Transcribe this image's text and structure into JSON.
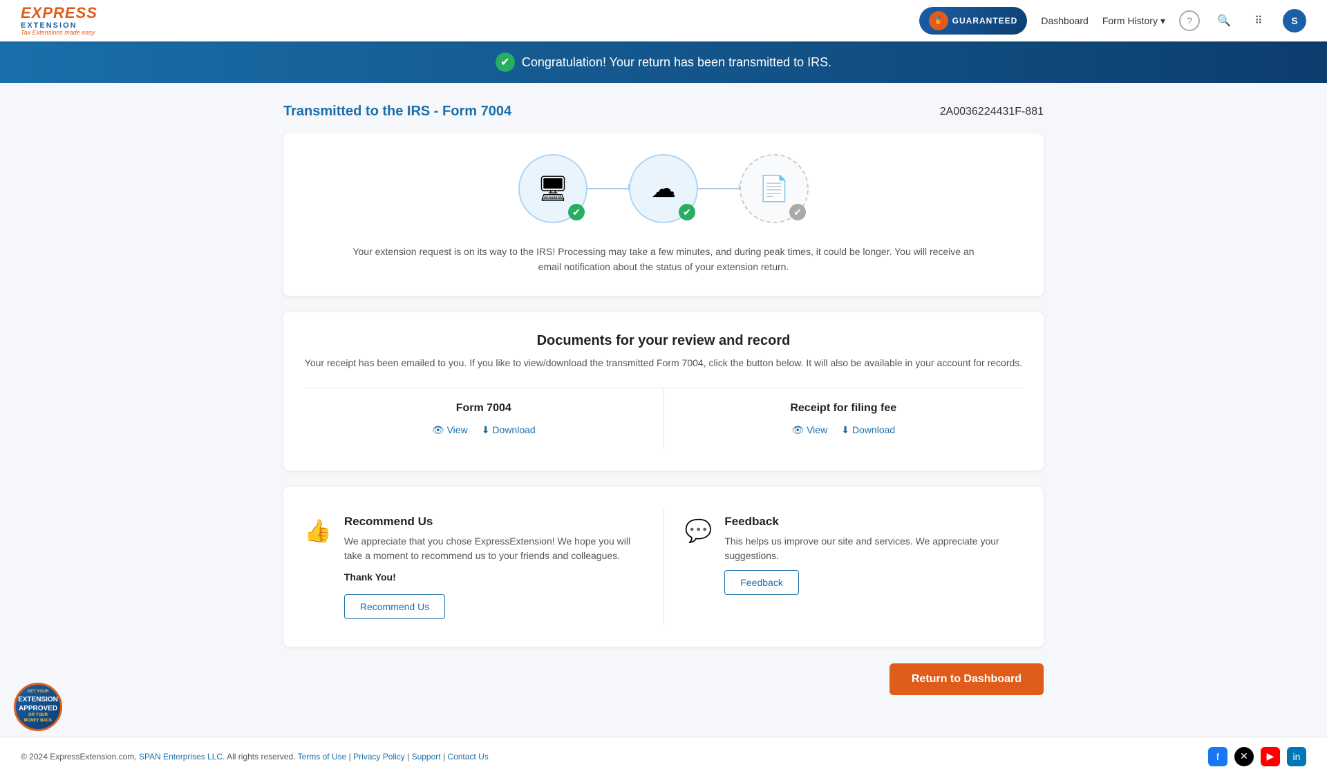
{
  "header": {
    "logo": {
      "express": "EXPRESS",
      "extension": "EXTENSION",
      "tagline": "Tax Extensions made easy"
    },
    "guaranteed_badge": "GUARANTEED",
    "nav": {
      "dashboard": "Dashboard",
      "form_history": "Form History",
      "help_icon": "?",
      "user_initial": "S"
    }
  },
  "banner": {
    "message": "Congratulation! Your return has been transmitted to IRS."
  },
  "page": {
    "title": "Transmitted to the IRS - Form 7004",
    "confirmation_code": "2A0036224431F-881"
  },
  "transmission_card": {
    "step1_icon": "🖥",
    "step2_icon": "☁",
    "step3_icon": "📄",
    "description": "Your extension request is on its way to the IRS! Processing may take a few minutes, and during peak times, it could be longer. You will receive an email notification about the status of your extension return."
  },
  "documents_card": {
    "title": "Documents for your review and record",
    "subtitle": "Your receipt has been emailed to you. If you like to view/download the transmitted Form 7004, click the button below. It will also be available in your account for records.",
    "form7004": {
      "title": "Form 7004",
      "view_label": "View",
      "download_label": "Download"
    },
    "receipt": {
      "title": "Receipt for filing fee",
      "view_label": "View",
      "download_label": "Download"
    }
  },
  "recommend_card": {
    "recommend": {
      "title": "Recommend Us",
      "description": "We appreciate that you chose ExpressExtension! We hope you will take a moment to recommend us to your friends and colleagues.",
      "thank_you": "Thank You!",
      "button_label": "Recommend Us"
    },
    "feedback": {
      "title": "Feedback",
      "description": "This helps us improve our site and services. We appreciate your suggestions.",
      "button_label": "Feedback"
    }
  },
  "actions": {
    "return_dashboard": "Return to Dashboard"
  },
  "footer": {
    "copyright": "© 2024 ExpressExtension.com,",
    "company": "SPAN Enterprises LLC.",
    "rights": "All rights reserved.",
    "terms": "Terms of Use",
    "privacy": "Privacy Policy",
    "support": "Support",
    "contact": "Contact Us"
  },
  "approved_badge": {
    "line1": "GET YOUR",
    "line2": "EXTENSION",
    "line3": "APPROVED",
    "line4": "OR YOUR",
    "line5": "MONEY BACK"
  }
}
